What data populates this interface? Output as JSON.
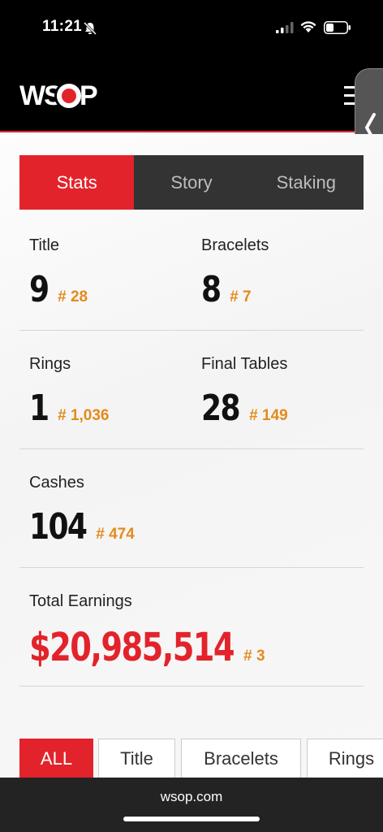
{
  "status_bar": {
    "time": "11:21"
  },
  "header": {
    "logo_left": "WS",
    "logo_right": "P"
  },
  "tabs": [
    {
      "label": "Stats",
      "active": true
    },
    {
      "label": "Story",
      "active": false
    },
    {
      "label": "Staking",
      "active": false
    }
  ],
  "stats": {
    "title": {
      "label": "Title",
      "value": "9",
      "rank": "# 28"
    },
    "bracelets": {
      "label": "Bracelets",
      "value": "8",
      "rank": "# 7"
    },
    "rings": {
      "label": "Rings",
      "value": "1",
      "rank": "# 1,036"
    },
    "final_tables": {
      "label": "Final Tables",
      "value": "28",
      "rank": "# 149"
    },
    "cashes": {
      "label": "Cashes",
      "value": "104",
      "rank": "# 474"
    },
    "total_earnings": {
      "label": "Total Earnings",
      "value": "$20,985,514",
      "rank": "# 3"
    }
  },
  "filter_tabs": [
    {
      "label": "ALL",
      "active": true
    },
    {
      "label": "Title",
      "active": false
    },
    {
      "label": "Bracelets",
      "active": false
    },
    {
      "label": "Rings",
      "active": false
    }
  ],
  "bottom_bar": {
    "url": "wsop.com"
  },
  "colors": {
    "accent": "#e3232b",
    "rank": "#e38b1c",
    "tab_bg": "#333333"
  }
}
